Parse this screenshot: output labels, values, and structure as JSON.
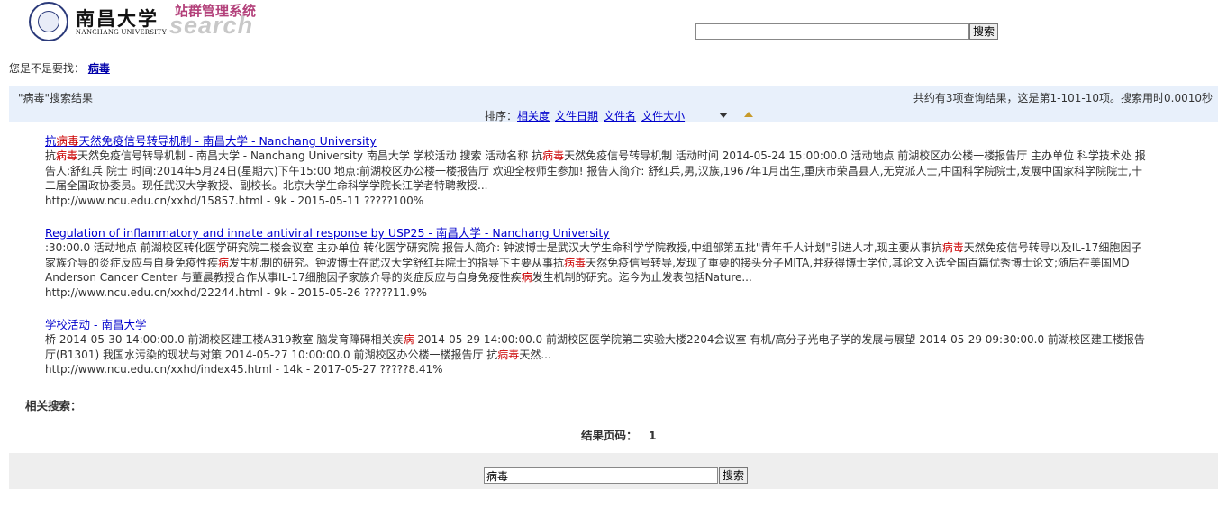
{
  "header": {
    "logo_cn": "南昌大学",
    "logo_en": "NANCHANG UNIVERSITY",
    "system_title": "站群管理系统",
    "system_sub": "search",
    "search_value": "",
    "search_button": "搜索"
  },
  "suggestion": {
    "prefix": "您是不是要找：",
    "term": "病毒"
  },
  "results_bar": {
    "query_label": "\"病毒\"搜索结果",
    "summary": "共约有3项查询结果，这是第1-101-10项。搜索用时0.0010秒",
    "sort_label": "排序：",
    "sort_options": [
      "相关度",
      "文件日期",
      "文件名",
      "文件大小"
    ]
  },
  "results": [
    {
      "title_pre": "抗",
      "title_hl": "病毒",
      "title_post": "天然免疫信号转导机制 - 南昌大学 - Nanchang University",
      "snippet": [
        {
          "t": "抗"
        },
        {
          "t": "病毒",
          "hl": true
        },
        {
          "t": "天然免疫信号转导机制 - 南昌大学 - Nanchang University 南昌大学 学校活动 搜索 活动名称 抗"
        },
        {
          "t": "病毒",
          "hl": true
        },
        {
          "t": "天然免疫信号转导机制 活动时间 2014-05-24 15:00:00.0 活动地点 前湖校区办公楼一楼报告厅 主办单位 科学技术处 报告人:舒红兵 院士 时间:2014年5月24日(星期六)下午15:00 地点:前湖校区办公楼一楼报告厅 欢迎全校师生参加! 报告人简介: 舒红兵,男,汉族,1967年1月出生,重庆市荣昌县人,无党派人士,中国科学院院士,发展中国家科学院院士,十二届全国政协委员。现任武汉大学教授、副校长。北京大学生命科学学院长江学者特聘教授..."
        }
      ],
      "url_line": "http://www.ncu.edu.cn/xxhd/15857.html -   9k - 2015-05-11   ?????100%"
    },
    {
      "title_pre": "Regulation of inflammatory and innate antiviral response by USP25 - 南昌大学 - Nanchang University",
      "title_hl": "",
      "title_post": "",
      "snippet": [
        {
          "t": ":30:00.0 活动地点 前湖校区转化医学研究院二楼会议室 主办单位 转化医学研究院 报告人简介: 钟波博士是武汉大学生命科学学院教授,中组部第五批\"青年千人计划\"引进人才,现主要从事抗"
        },
        {
          "t": "病毒",
          "hl": true
        },
        {
          "t": "天然免疫信号转导以及IL-17细胞因子家族介导的炎症反应与自身免疫性疾"
        },
        {
          "t": "病",
          "hl": true
        },
        {
          "t": "发生机制的研究。钟波博士在武汉大学舒红兵院士的指导下主要从事抗"
        },
        {
          "t": "病毒",
          "hl": true
        },
        {
          "t": "天然免疫信号转导,发现了重要的接头分子MITA,并获得博士学位,其论文入选全国百篇优秀博士论文;随后在美国MD Anderson Cancer Center 与董晨教授合作从事IL-17细胞因子家族介导的炎症反应与自身免疫性疾"
        },
        {
          "t": "病",
          "hl": true
        },
        {
          "t": "发生机制的研究。迄今为止发表包括Nature..."
        }
      ],
      "url_line": "http://www.ncu.edu.cn/xxhd/22244.html -   9k - 2015-05-26   ?????11.9%"
    },
    {
      "title_pre": "学校活动 - 南昌大学",
      "title_hl": "",
      "title_post": "",
      "snippet": [
        {
          "t": "桥 2014-05-30 14:00:00.0 前湖校区建工楼A319教室 脑发育障碍相关疾"
        },
        {
          "t": "病",
          "hl": true
        },
        {
          "t": " 2014-05-29 14:00:00.0 前湖校区医学院第二实验大楼2204会议室 有机/高分子光电子学的发展与展望 2014-05-29 09:30:00.0 前湖校区建工楼报告厅(B1301) 我国水污染的现状与对策 2014-05-27 10:00:00.0 前湖校区办公楼一楼报告厅 抗"
        },
        {
          "t": "病毒",
          "hl": true
        },
        {
          "t": "天然..."
        }
      ],
      "url_line": "http://www.ncu.edu.cn/xxhd/index45.html -   14k - 2017-05-27   ?????8.41%"
    }
  ],
  "related_label": "相关搜索：",
  "pager": {
    "label": "结果页码：",
    "page": "1"
  },
  "bottom_search": {
    "value": "病毒",
    "button": "搜索"
  }
}
